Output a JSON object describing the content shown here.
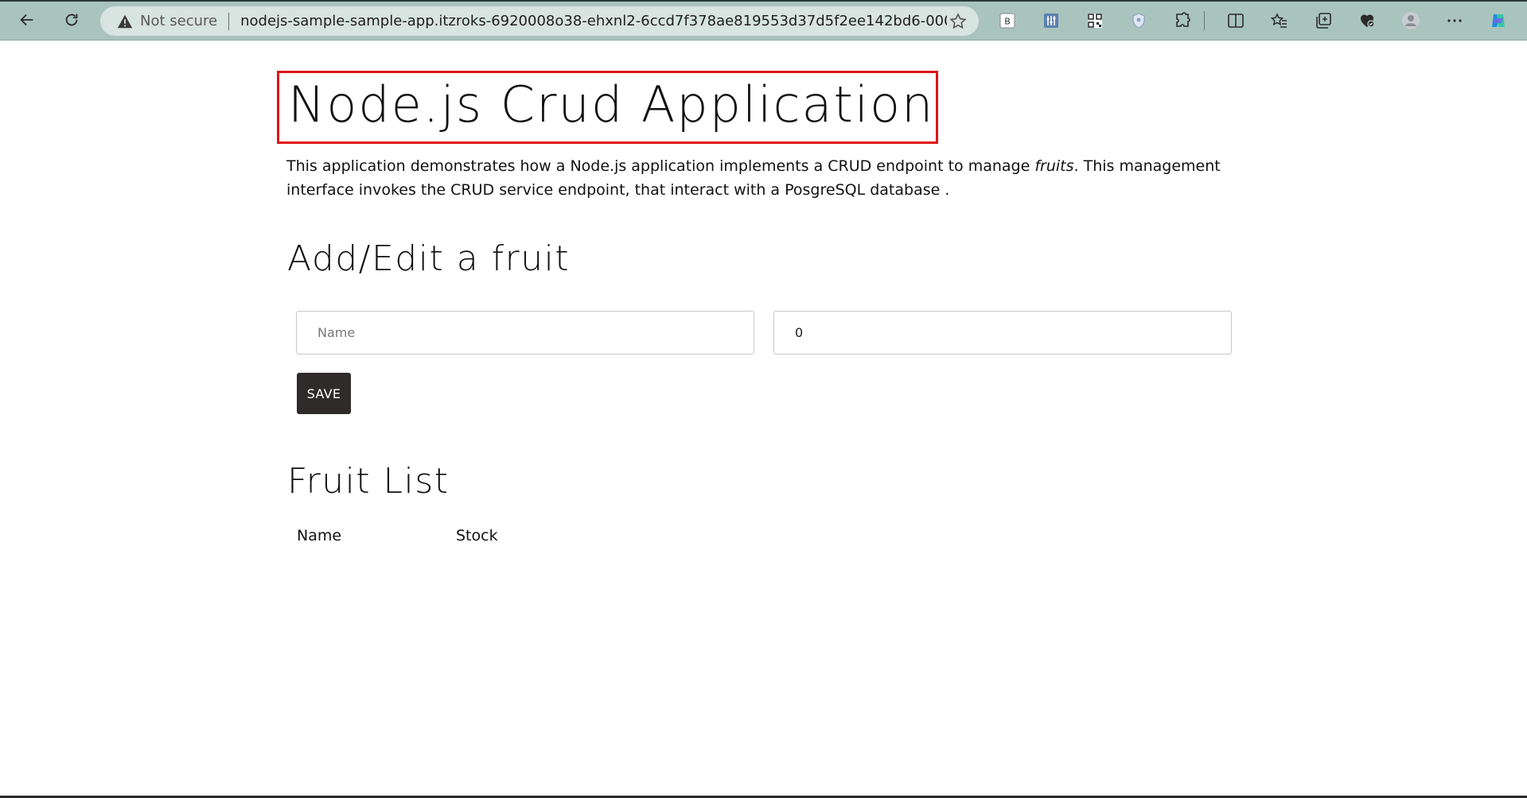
{
  "browser": {
    "security_label": "Not secure",
    "url": "nodejs-sample-sample-app.itzroks-6920008o38-ehxnl2-6ccd7f378ae819553d37d5f2ee142bd6-0000.eu-de.conta...",
    "toolbar_icons": [
      "b-extension-icon",
      "equalizer-extension-icon",
      "qr-code-icon",
      "shield-extension-icon",
      "extensions-puzzle-icon",
      "split-screen-icon",
      "favorites-icon",
      "collections-icon",
      "browser-essentials-icon",
      "profile-avatar-icon",
      "more-menu-icon",
      "copilot-icon"
    ],
    "b_extension_label": "B"
  },
  "page": {
    "title": "Node.js Crud Application",
    "intro_part1": "This application demonstrates how a Node.js application implements a CRUD endpoint to manage ",
    "intro_emphasis": "fruits",
    "intro_part2": ". This management interface invokes the CRUD service endpoint, that interact with a PosgreSQL database ."
  },
  "form": {
    "heading": "Add/Edit a fruit",
    "name_placeholder": "Name",
    "stock_value": "0",
    "save_label": "SAVE"
  },
  "list": {
    "heading": "Fruit List",
    "columns": [
      "Name",
      "Stock"
    ]
  },
  "colors": {
    "toolbar": "#a9c4bd",
    "title_highlight": "#e0141b",
    "save_button": "#2f2b2a"
  }
}
